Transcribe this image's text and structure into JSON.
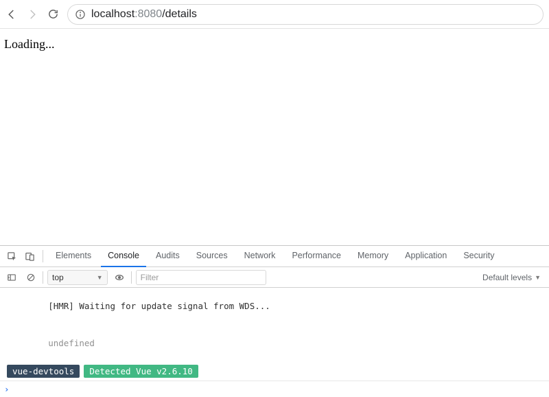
{
  "toolbar": {
    "url_host": "localhost",
    "url_port": ":8080",
    "url_path": "/details"
  },
  "page": {
    "loading_text": "Loading..."
  },
  "devtools": {
    "tabs": [
      "Elements",
      "Console",
      "Audits",
      "Sources",
      "Network",
      "Performance",
      "Memory",
      "Application",
      "Security"
    ],
    "active_tab_index": 1,
    "filter": {
      "context_label": "top",
      "placeholder": "Filter",
      "levels_label": "Default levels"
    },
    "logs": {
      "hmr_line": "  [HMR] Waiting for update signal from WDS...",
      "undef_line": "  undefined",
      "badge_dark": " vue-devtools ",
      "badge_green": " Detected Vue v2.6.10 "
    }
  }
}
